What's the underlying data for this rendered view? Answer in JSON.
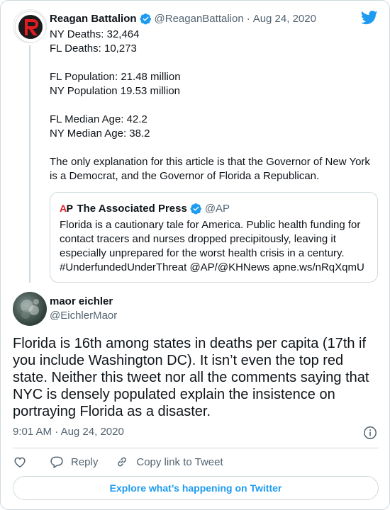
{
  "colors": {
    "twitter_blue": "#1d9bf0",
    "text": "#0f1419",
    "secondary_text": "#536471",
    "border": "#cfd9de",
    "ap_red": "#e31b23",
    "logo_red": "#e31b23"
  },
  "quoted_tweet": {
    "author_name": "Reagan Battalion",
    "handle": "@ReaganBattalion",
    "separator": "·",
    "date": "Aug 24, 2020",
    "lines": [
      "NY Deaths: 32,464",
      "FL Deaths: 10,273",
      "",
      "FL Population: 21.48 million",
      "NY Population 19.53 million",
      "",
      "FL Median Age: 42.2",
      "NY Median Age: 38.2",
      "",
      "The only explanation for this article is that the Governor of New York",
      "is a Democrat, and the Governor of Florida a Republican."
    ],
    "embedded": {
      "logo_a": "A",
      "logo_p": "P",
      "author_name": "The Associated Press",
      "handle": "@AP",
      "lines": [
        "Florida is a cautionary tale for America. Public health funding for",
        "contact tracers and nurses dropped precipitously, leaving it",
        "especially unprepared for the worst health crisis in a century.",
        "#UnderfundedUnderThreat @AP/@KHNews apne.ws/nRqXqmU"
      ]
    }
  },
  "reply_tweet": {
    "author_name": "maor eichler",
    "handle": "@EichlerMaor",
    "lines": [
      "Florida is 16th among states in deaths per capita (17th if",
      "you include Washington DC). It isn’t even the top red",
      "state. Neither this tweet nor all the comments saying that",
      "NYC is densely populated explain the insistence on",
      "portraying Florida as a disaster."
    ],
    "time": "9:01 AM",
    "separator": "·",
    "date": "Aug 24, 2020"
  },
  "actions": {
    "like_icon": "heart-icon",
    "reply_label": "Reply",
    "copy_label": "Copy link to Tweet"
  },
  "explore_label": "Explore what’s happening on Twitter"
}
